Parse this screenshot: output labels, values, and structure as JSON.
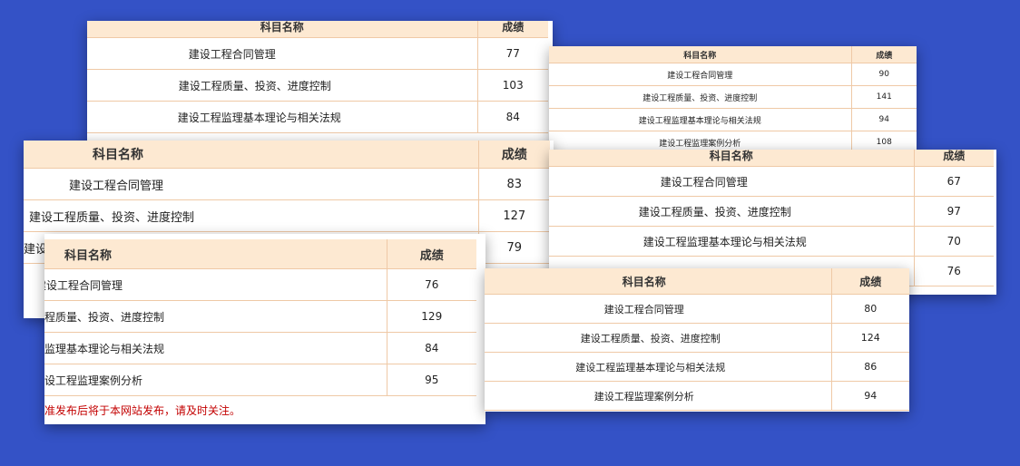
{
  "cards": {
    "a": {
      "header": {
        "subject": "科目名称",
        "score": "成绩"
      },
      "rows": [
        {
          "subject": "建设工程合同管理",
          "score": "77"
        },
        {
          "subject": "建设工程质量、投资、进度控制",
          "score": "103"
        },
        {
          "subject": "建设工程监理基本理论与相关法规",
          "score": "84"
        }
      ]
    },
    "b": {
      "header": {
        "subject": "科目名称",
        "score": "成绩"
      },
      "rows": [
        {
          "subject": "建设工程合同管理",
          "score": "90"
        },
        {
          "subject": "建设工程质量、投资、进度控制",
          "score": "141"
        },
        {
          "subject": "建设工程监理基本理论与相关法规",
          "score": "94"
        },
        {
          "subject": "建设工程监理案例分析",
          "score": "108"
        }
      ]
    },
    "c": {
      "header": {
        "subject": "科目名称",
        "score": "成绩"
      },
      "rows": [
        {
          "subject": "建设工程合同管理",
          "score": "83"
        },
        {
          "subject": "建设工程质量、投资、进度控制",
          "score": "127"
        },
        {
          "subject": "建设",
          "score": "79"
        }
      ]
    },
    "d": {
      "header": {
        "subject": "科目名称",
        "score": "成绩"
      },
      "rows": [
        {
          "subject": "建设工程合同管理",
          "score": "67"
        },
        {
          "subject": "建设工程质量、投资、进度控制",
          "score": "97"
        },
        {
          "subject": "建设工程监理基本理论与相关法规",
          "score": "70"
        },
        {
          "subject": "",
          "score": "76"
        }
      ]
    },
    "e": {
      "header": {
        "subject": "科目名称",
        "score": "成绩"
      },
      "rows": [
        {
          "subject": "建设工程合同管理",
          "score": "76"
        },
        {
          "subject": "程质量、投资、进度控制",
          "score": "129"
        },
        {
          "subject": "监理基本理论与相关法规",
          "score": "84"
        },
        {
          "subject": "设工程监理案例分析",
          "score": "95"
        }
      ],
      "note": "准发布后将于本网站发布，请及时关注。"
    },
    "f": {
      "header": {
        "subject": "科目名称",
        "score": "成绩"
      },
      "rows": [
        {
          "subject": "建设工程合同管理",
          "score": "80"
        },
        {
          "subject": "建设工程质量、投资、进度控制",
          "score": "124"
        },
        {
          "subject": "建设工程监理基本理论与相关法规",
          "score": "86"
        },
        {
          "subject": "建设工程监理案例分析",
          "score": "94"
        }
      ]
    }
  },
  "colors": {
    "background": "#3452c6",
    "header_bg": "#fde9d2",
    "border": "#efc9a6",
    "note": "#c30000"
  }
}
